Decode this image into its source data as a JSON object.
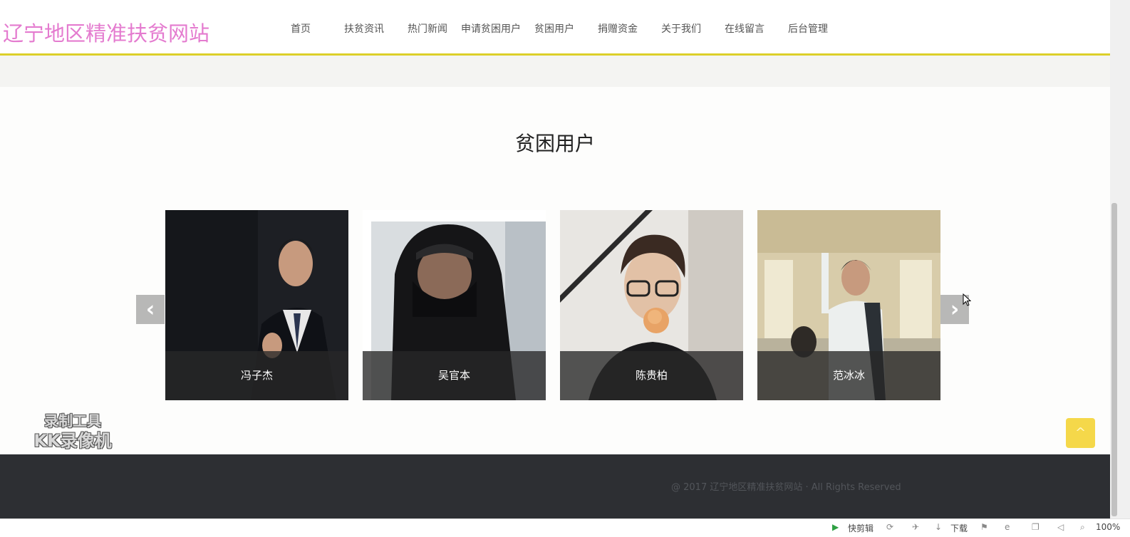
{
  "header": {
    "site_title": "辽宁地区精准扶贫网站",
    "nav": [
      {
        "label": "首页"
      },
      {
        "label": "扶贫资讯"
      },
      {
        "label": "热门新闻"
      },
      {
        "label": "申请贫困用户"
      },
      {
        "label": "贫困用户"
      },
      {
        "label": "捐赠资金"
      },
      {
        "label": "关于我们"
      },
      {
        "label": "在线留言"
      },
      {
        "label": "后台管理"
      }
    ],
    "accent_color": "#dccf2a",
    "title_color": "#e47bcf"
  },
  "section": {
    "title": "贫困用户",
    "cards": [
      {
        "name": "冯子杰",
        "photo_icon": "person-in-suit-photo"
      },
      {
        "name": "吴官本",
        "photo_icon": "person-in-hood-photo"
      },
      {
        "name": "陈贵柏",
        "photo_icon": "person-with-rose-photo"
      },
      {
        "name": "范冰冰",
        "photo_icon": "person-on-train-photo"
      }
    ],
    "prev_arrow": "‹",
    "next_arrow": "›"
  },
  "watermark": {
    "line1": "录制工具",
    "line2": "KK录像机"
  },
  "back_to_top": "^",
  "footer": {
    "copyright": "@ 2017 辽宁地区精准扶贫网站 · All Rights Reserved"
  },
  "statusbar": {
    "quick_clip": "快剪辑",
    "download": "下载",
    "zoom": "100%"
  }
}
